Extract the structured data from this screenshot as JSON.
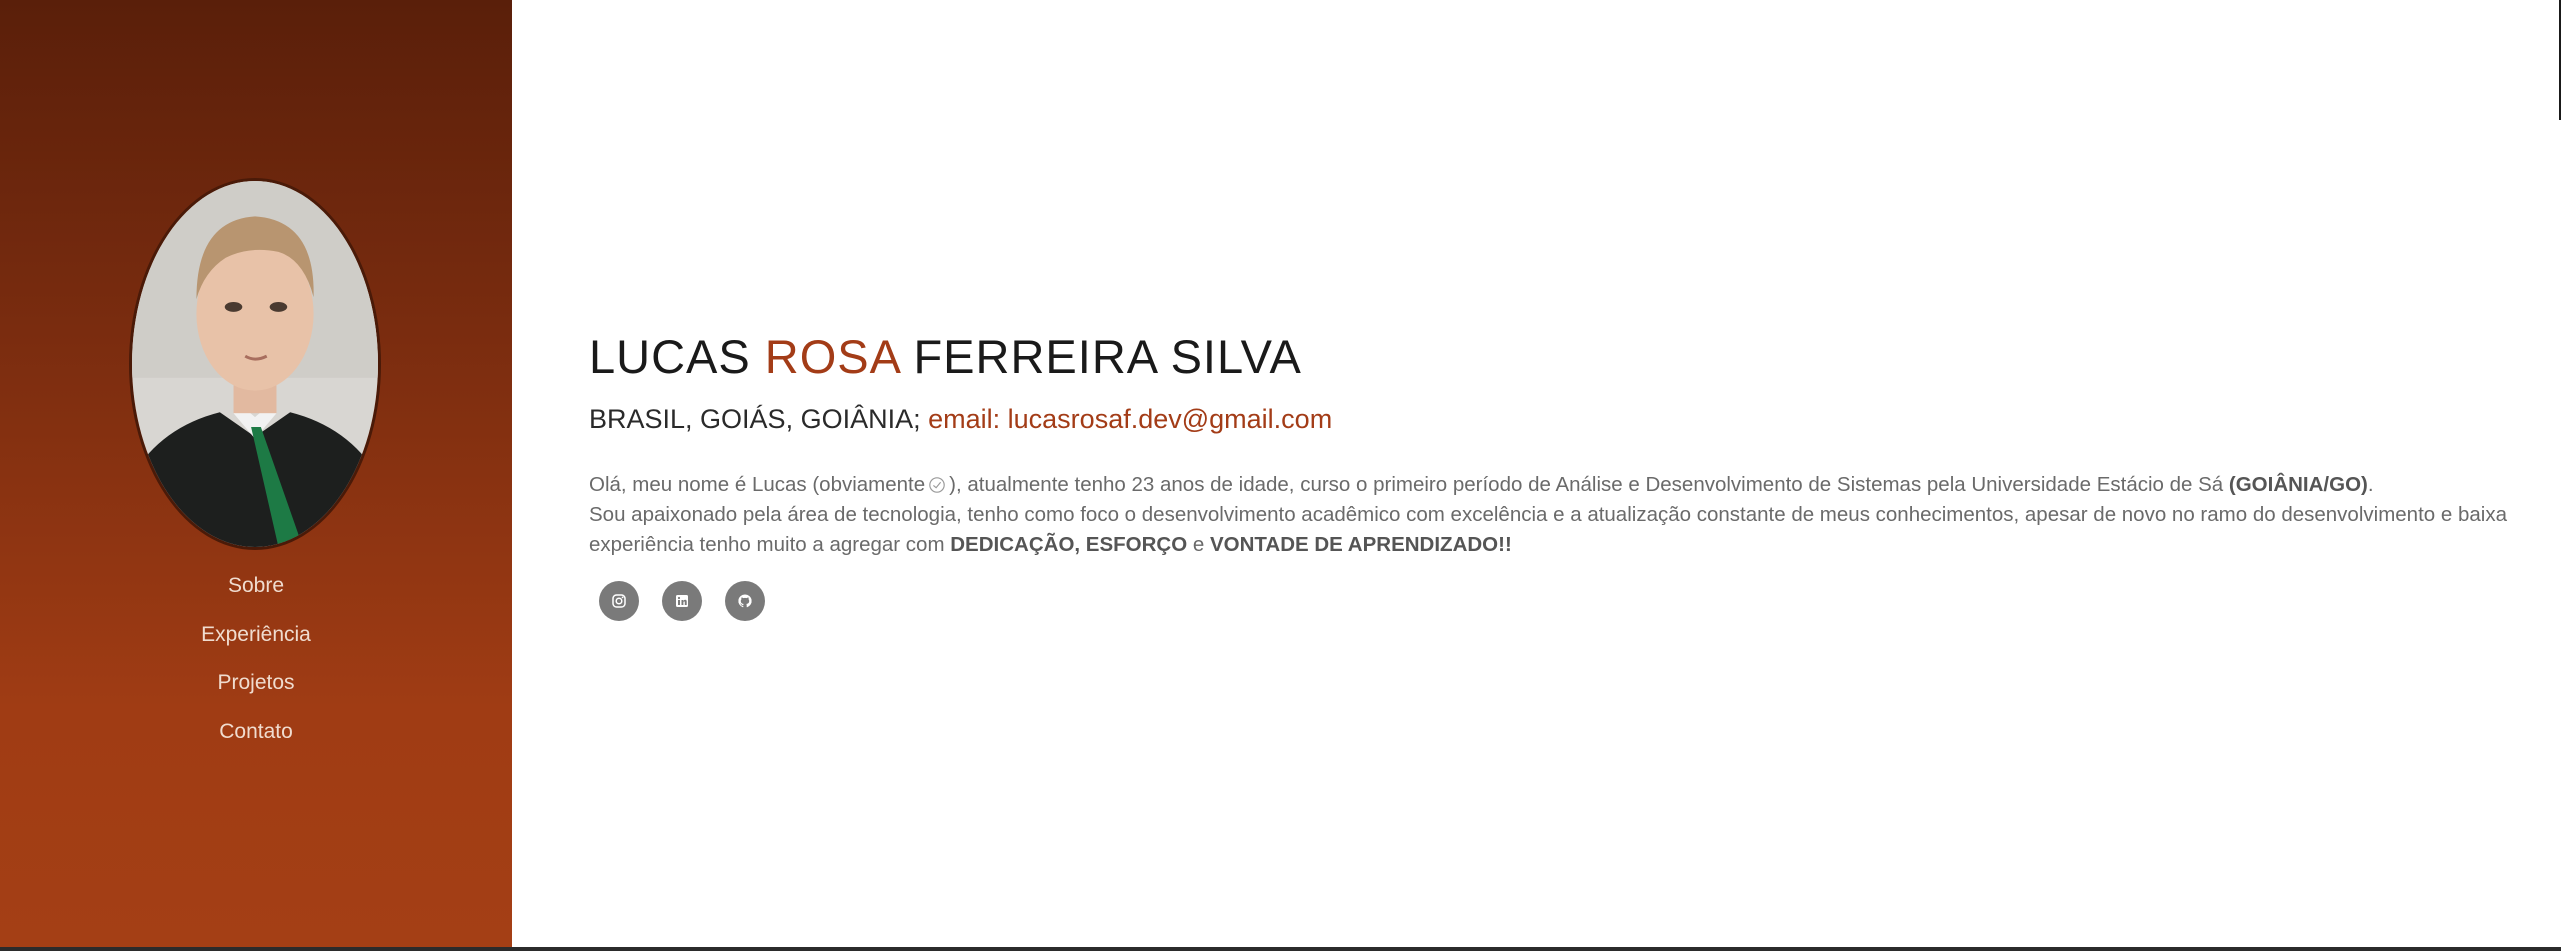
{
  "profile": {
    "first_name": "LUCAS",
    "middle_name": "ROSA",
    "last_name": "FERREIRA SILVA",
    "location": "BRASIL, GOIÁS, GOIÂNIA;",
    "email_label": "email:",
    "email": "lucasrosaf.dev@gmail.com"
  },
  "about": {
    "p1_a": "Olá, meu nome é Lucas (obviamente",
    "p1_b": "), atualmente tenho 23 anos de idade, curso o primeiro período de Análise e Desenvolvimento de Sistemas pela Universidade Estácio de Sá",
    "p1_bold": "(GOIÂNIA/GO)",
    "p1_end": ".",
    "p2_a": "Sou apaixonado pela área de tecnologia, tenho como foco o desenvolvimento acadêmico com excelência e a atualização constante de meus conhecimentos, apesar de novo no ramo do desenvolvimento e baixa experiência tenho muito a agregar com",
    "p2_bold1": "DEDICAÇÃO, ESFORÇO",
    "p2_mid": "e",
    "p2_bold2": "VONTADE DE APRENDIZADO!!"
  },
  "nav": {
    "items": [
      {
        "label": "Sobre"
      },
      {
        "label": "Experiência"
      },
      {
        "label": "Projetos"
      },
      {
        "label": "Contato"
      }
    ]
  },
  "socials": {
    "items": [
      {
        "icon": "instagram-icon"
      },
      {
        "icon": "linkedin-icon"
      },
      {
        "icon": "github-icon"
      }
    ]
  },
  "colors": {
    "accent": "#a33c17",
    "sidebar_top": "#5a1f0a",
    "sidebar_bottom": "#a43f15",
    "social_button": "#7a7a7a"
  }
}
